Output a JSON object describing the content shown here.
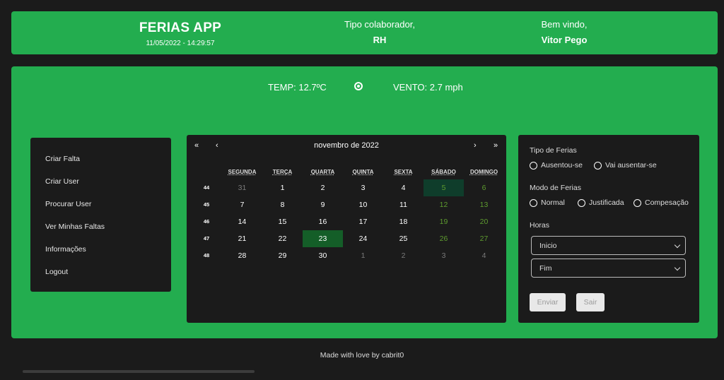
{
  "header": {
    "app_title": "FERIAS APP",
    "datetime": "11/05/2022 - 14:29:57",
    "role_label": "Tipo colaborador,",
    "role_value": "RH",
    "welcome_label": "Bem vindo,",
    "user_name": "Vitor Pego"
  },
  "weather": {
    "temp": "TEMP: 12.7ºC",
    "wind": "VENTO: 2.7 mph",
    "icon": "sun-icon"
  },
  "sidebar": {
    "items": [
      "Criar Falta",
      "Criar User",
      "Procurar User",
      "Ver Minhas Faltas",
      "Informações",
      "Logout"
    ]
  },
  "calendar": {
    "nav": {
      "first": "«",
      "prev": "‹",
      "next": "›",
      "last": "»"
    },
    "month_label": "novembro de 2022",
    "weekdays": [
      "SEGUNDA",
      "TERÇA",
      "QUARTA",
      "QUINTA",
      "SEXTA",
      "SÁBADO",
      "DOMINGO"
    ],
    "weeks": [
      {
        "num": "44",
        "days": [
          "31",
          "1",
          "2",
          "3",
          "4",
          "5",
          "6"
        ]
      },
      {
        "num": "45",
        "days": [
          "7",
          "8",
          "9",
          "10",
          "11",
          "12",
          "13"
        ]
      },
      {
        "num": "46",
        "days": [
          "14",
          "15",
          "16",
          "17",
          "18",
          "19",
          "20"
        ]
      },
      {
        "num": "47",
        "days": [
          "21",
          "22",
          "23",
          "24",
          "25",
          "26",
          "27"
        ]
      },
      {
        "num": "48",
        "days": [
          "28",
          "29",
          "30",
          "1",
          "2",
          "3",
          "4"
        ]
      }
    ],
    "selected_day": "23",
    "highlighted_day": "5"
  },
  "form": {
    "tipo_label": "Tipo de Ferias",
    "tipo_options": [
      "Ausentou-se",
      "Vai ausentar-se"
    ],
    "modo_label": "Modo de Ferias",
    "modo_options": [
      "Normal",
      "Justificada",
      "Compesação"
    ],
    "horas_label": "Horas",
    "inicio": "Inicio",
    "fim": "Fim",
    "enviar": "Enviar",
    "sair": "Sair"
  },
  "footer": {
    "text": "Made with love by cabrit0"
  },
  "colors": {
    "accent": "#23ad4f",
    "panel": "#1b1b1b",
    "selected": "#145e28",
    "weekend": "#5e9b2f"
  }
}
